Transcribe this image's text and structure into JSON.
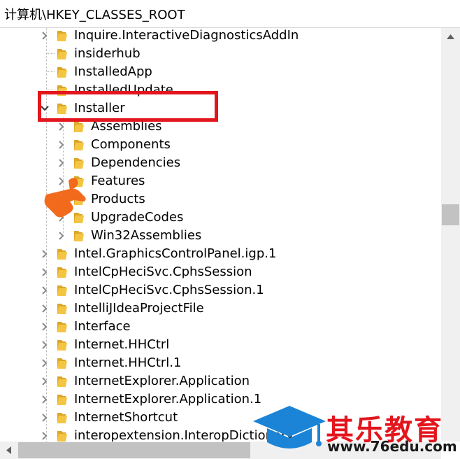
{
  "address_bar": {
    "path": "计算机\\HKEY_CLASSES_ROOT"
  },
  "tree": {
    "items": [
      {
        "label": "Inquire.InteractiveDiagnosticsAddIn",
        "level": 1,
        "expander": "collapsed"
      },
      {
        "label": "insiderhub",
        "level": 1,
        "expander": "none"
      },
      {
        "label": "InstalledApp",
        "level": 1,
        "expander": "none"
      },
      {
        "label": "InstalledUpdate",
        "level": 1,
        "expander": "none"
      },
      {
        "label": "Installer",
        "level": 1,
        "expander": "expanded"
      },
      {
        "label": "Assemblies",
        "level": 2,
        "expander": "collapsed"
      },
      {
        "label": "Components",
        "level": 2,
        "expander": "collapsed"
      },
      {
        "label": "Dependencies",
        "level": 2,
        "expander": "collapsed"
      },
      {
        "label": "Features",
        "level": 2,
        "expander": "collapsed"
      },
      {
        "label": "Products",
        "level": 2,
        "expander": "collapsed"
      },
      {
        "label": "UpgradeCodes",
        "level": 2,
        "expander": "collapsed"
      },
      {
        "label": "Win32Assemblies",
        "level": 2,
        "expander": "collapsed"
      },
      {
        "label": "Intel.GraphicsControlPanel.igp.1",
        "level": 1,
        "expander": "collapsed"
      },
      {
        "label": "IntelCpHeciSvc.CphsSession",
        "level": 1,
        "expander": "collapsed"
      },
      {
        "label": "IntelCpHeciSvc.CphsSession.1",
        "level": 1,
        "expander": "collapsed"
      },
      {
        "label": "IntelliJIdeaProjectFile",
        "level": 1,
        "expander": "collapsed"
      },
      {
        "label": "Interface",
        "level": 1,
        "expander": "collapsed"
      },
      {
        "label": "Internet.HHCtrl",
        "level": 1,
        "expander": "collapsed"
      },
      {
        "label": "Internet.HHCtrl.1",
        "level": 1,
        "expander": "collapsed"
      },
      {
        "label": "InternetExplorer.Application",
        "level": 1,
        "expander": "collapsed"
      },
      {
        "label": "InternetExplorer.Application.1",
        "level": 1,
        "expander": "collapsed"
      },
      {
        "label": "InternetShortcut",
        "level": 1,
        "expander": "collapsed"
      },
      {
        "label": "interopextension.InteropDictionary",
        "level": 1,
        "expander": "collapsed"
      }
    ]
  },
  "watermark": {
    "brand": "其乐教育",
    "site": "www.76edu.com"
  },
  "colors": {
    "folder": "#f4c542",
    "folder_dark": "#dca628",
    "highlight": "#e3151d",
    "hand": "#f26b1d",
    "logo_blue": "#1b84d6",
    "scrollbar_track": "#f0f0f0",
    "scrollbar_thumb": "#c2c2c2"
  },
  "icons": {
    "collapsed": "chevron-right-icon",
    "expanded": "chevron-down-icon",
    "folder": "folder-icon"
  }
}
